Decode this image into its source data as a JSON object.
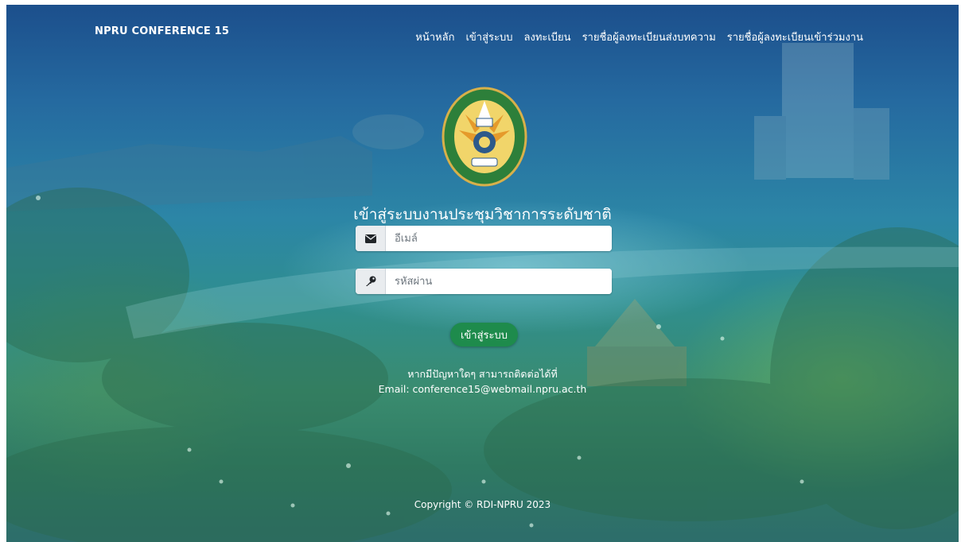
{
  "brand": "NPRU CONFERENCE 15",
  "nav": [
    {
      "label": "หน้าหลัก"
    },
    {
      "label": "เข้าสู่ระบบ"
    },
    {
      "label": "ลงทะเบียน"
    },
    {
      "label": "รายชื่อผู้ลงทะเบียนส่งบทความ"
    },
    {
      "label": "รายชื่อผู้ลงทะเบียนเข้าร่วมงาน"
    }
  ],
  "login": {
    "title": "เข้าสู่ระบบงานประชุมวิชาการระดับชาติ",
    "email_placeholder": "อีเมล์",
    "email_icon": "envelope-icon",
    "password_placeholder": "รหัสผ่าน",
    "password_icon": "key-icon",
    "submit_label": "เข้าสู่ระบบ"
  },
  "help": {
    "line1": "หากมีปัญหาใดๆ สามารถติดต่อได้ที่",
    "line2": "Email: conference15@webmail.npru.ac.th"
  },
  "footer": {
    "copyright": "Copyright © RDI-NPRU 2023"
  },
  "colors": {
    "accent": "#1e8b4c",
    "overlay_top": "#1c4f8c",
    "overlay_bottom": "#2f7a63"
  }
}
